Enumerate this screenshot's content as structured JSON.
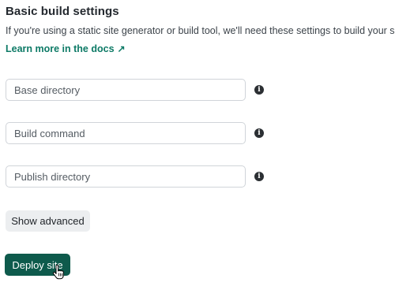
{
  "section": {
    "title": "Basic build settings",
    "description": "If you're using a static site generator or build tool, we'll need these settings to build your site.",
    "learn_more": "Learn more in the docs",
    "learn_more_arrow": "↗"
  },
  "fields": {
    "base_directory": {
      "placeholder": "Base directory",
      "value": ""
    },
    "build_command": {
      "placeholder": "Build command",
      "value": ""
    },
    "publish_directory": {
      "placeholder": "Publish directory",
      "value": ""
    }
  },
  "info_glyph": "i",
  "buttons": {
    "show_advanced": "Show advanced",
    "deploy_site": "Deploy site"
  },
  "colors": {
    "link": "#0d7a66",
    "primary_button": "#0e5a4c",
    "secondary_button": "#eceef0"
  }
}
